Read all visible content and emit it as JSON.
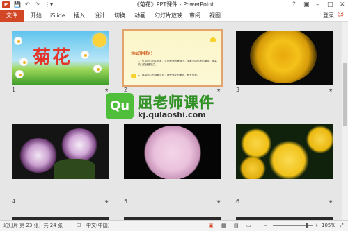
{
  "window": {
    "title": "《菊花》PPT课件 - PowerPoint",
    "app_logo": "P",
    "controls": [
      "?",
      "▣",
      "–",
      "□",
      "✕"
    ],
    "quick_access": [
      "💾",
      "↶",
      "↷",
      "⋮",
      "▾"
    ]
  },
  "ribbon": {
    "file_tab": "文件",
    "tabs": [
      "开始",
      "iSlide",
      "插入",
      "设计",
      "切换",
      "动画",
      "幻灯片放映",
      "审阅",
      "视图"
    ],
    "login": "登录",
    "feedback": "☺"
  },
  "slides": [
    {
      "number": "1",
      "title": "菊花",
      "has_animation": true
    },
    {
      "number": "2",
      "heading": "活动目标：",
      "lines": [
        "1、引导幼儿自主欣赏，认识秋菊的基础上，学着不同形状的菊花，提高幼儿的创造能力。",
        "2、提高幼儿的观察意识，感受菊花的美丽，秋天的美。"
      ],
      "has_animation": true
    },
    {
      "number": "3",
      "has_animation": true
    },
    {
      "number": "4",
      "has_animation": true
    },
    {
      "number": "5",
      "has_animation": true
    },
    {
      "number": "6",
      "has_animation": true
    }
  ],
  "star_glyph": "★",
  "watermark": {
    "badge": "Qu",
    "title": "屈老师课件",
    "url": "kj.qulaoshi.com"
  },
  "status": {
    "slide_info": "幻灯片 第 23 张，共 24 张",
    "language": "中文(中国)",
    "zoom": "105%"
  },
  "colors": {
    "accent": "#d24726",
    "selection": "#e3a36c",
    "watermark_green": "#4fbf3b"
  }
}
